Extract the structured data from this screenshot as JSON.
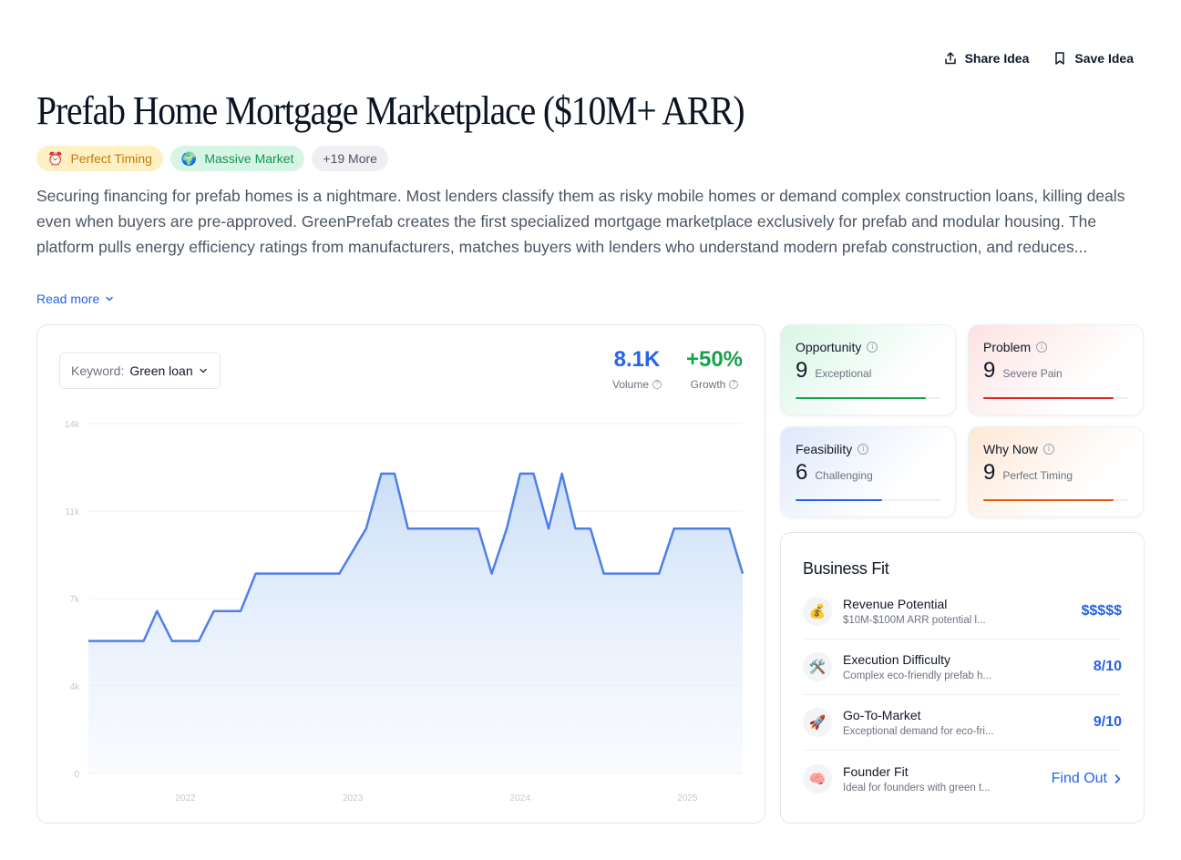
{
  "actions": {
    "share_label": "Share Idea",
    "save_label": "Save Idea"
  },
  "title": "Prefab Home Mortgage Marketplace ($10M+ ARR)",
  "badges": [
    {
      "emoji": "⏰",
      "label": "Perfect Timing"
    },
    {
      "emoji": "🌍",
      "label": "Massive Market"
    },
    {
      "label": "+19 More"
    }
  ],
  "description": "Securing financing for prefab homes is a nightmare. Most lenders classify them as risky mobile homes or demand complex construction loans, killing deals even when buyers are pre-approved. GreenPrefab creates the first specialized mortgage marketplace exclusively for prefab and modular housing. The platform pulls energy efficiency ratings from manufacturers, matches buyers with lenders who understand modern prefab construction, and reduces...",
  "read_more_label": "Read more",
  "keyword": {
    "label": "Keyword:",
    "value": "Green loan"
  },
  "stats": {
    "volume": {
      "value": "8.1K",
      "label": "Volume"
    },
    "growth": {
      "value": "+50%",
      "label": "Growth"
    }
  },
  "chart_data": {
    "type": "area",
    "yticks": [
      "14k",
      "11k",
      "7k",
      "4k",
      "0"
    ],
    "yvalues": [
      14000,
      10500,
      7000,
      3500,
      0
    ],
    "ylim": [
      0,
      14000
    ],
    "xticks": [
      {
        "label": "2022",
        "x": 2022.0
      },
      {
        "label": "2023",
        "x": 2023.0
      },
      {
        "label": "2024",
        "x": 2024.0
      },
      {
        "label": "2025",
        "x": 2025.0
      }
    ],
    "xlim": [
      2021.42,
      2025.33
    ],
    "color": "#4f7fe8",
    "points": [
      [
        2021.42,
        5300
      ],
      [
        2021.75,
        5300
      ],
      [
        2021.83,
        6500
      ],
      [
        2021.92,
        5300
      ],
      [
        2022.08,
        5300
      ],
      [
        2022.17,
        6500
      ],
      [
        2022.33,
        6500
      ],
      [
        2022.42,
        8000
      ],
      [
        2022.67,
        8000
      ],
      [
        2022.92,
        8000
      ],
      [
        2023.08,
        9800
      ],
      [
        2023.17,
        12000
      ],
      [
        2023.25,
        12000
      ],
      [
        2023.33,
        9800
      ],
      [
        2023.5,
        9800
      ],
      [
        2023.75,
        9800
      ],
      [
        2023.83,
        8000
      ],
      [
        2023.92,
        9800
      ],
      [
        2024.0,
        12000
      ],
      [
        2024.08,
        12000
      ],
      [
        2024.17,
        9800
      ],
      [
        2024.25,
        12000
      ],
      [
        2024.33,
        9800
      ],
      [
        2024.42,
        9800
      ],
      [
        2024.5,
        8000
      ],
      [
        2024.67,
        8000
      ],
      [
        2024.83,
        8000
      ],
      [
        2024.92,
        9800
      ],
      [
        2025.0,
        9800
      ],
      [
        2025.17,
        9800
      ],
      [
        2025.25,
        9800
      ],
      [
        2025.33,
        8000
      ]
    ]
  },
  "scores": [
    {
      "key": "opportunity",
      "title": "Opportunity",
      "score": "9",
      "word": "Exceptional",
      "level": 0.9,
      "color": "#16a34a"
    },
    {
      "key": "problem",
      "title": "Problem",
      "score": "9",
      "word": "Severe Pain",
      "level": 0.9,
      "color": "#dc2626"
    },
    {
      "key": "feasibility",
      "title": "Feasibility",
      "score": "6",
      "word": "Challenging",
      "level": 0.6,
      "color": "#2563eb"
    },
    {
      "key": "whynow",
      "title": "Why Now",
      "score": "9",
      "word": "Perfect Timing",
      "level": 0.9,
      "color": "#ea580c"
    }
  ],
  "business_fit": {
    "title": "Business Fit",
    "items": [
      {
        "emoji": "💰",
        "name": "Revenue Potential",
        "sub": "$10M-$100M ARR potential l...",
        "value": "$$$$$"
      },
      {
        "emoji": "🛠️",
        "name": "Execution Difficulty",
        "sub": "Complex eco-friendly prefab h...",
        "value": "8/10"
      },
      {
        "emoji": "🚀",
        "name": "Go-To-Market",
        "sub": "Exceptional demand for eco-fri...",
        "value": "9/10"
      },
      {
        "emoji": "🧠",
        "name": "Founder Fit",
        "sub": "Ideal for founders with green t...",
        "value": "Find Out"
      }
    ]
  }
}
